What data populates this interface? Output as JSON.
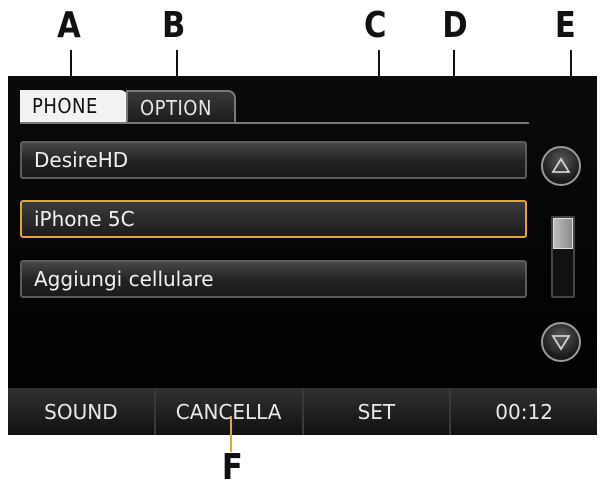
{
  "callouts": {
    "a": "A",
    "b": "B",
    "c": "C",
    "d": "D",
    "e": "E",
    "f": "F"
  },
  "tabs": [
    {
      "label": "PHONE",
      "active": true
    },
    {
      "label": "OPTION",
      "active": false
    }
  ],
  "devices": [
    {
      "label": "DesireHD",
      "selected": false
    },
    {
      "label": "iPhone 5C",
      "selected": true
    },
    {
      "label": "Aggiungi cellulare",
      "selected": false
    }
  ],
  "scrollbar": {
    "position": 0.0,
    "visible_fraction": 0.4
  },
  "bottom_bar": [
    "SOUND",
    "CANCELLA",
    "SET",
    "00:12"
  ],
  "colors": {
    "selection_border": "#e5a330",
    "screen_background": "#000000",
    "text": "#f0f0f0"
  }
}
